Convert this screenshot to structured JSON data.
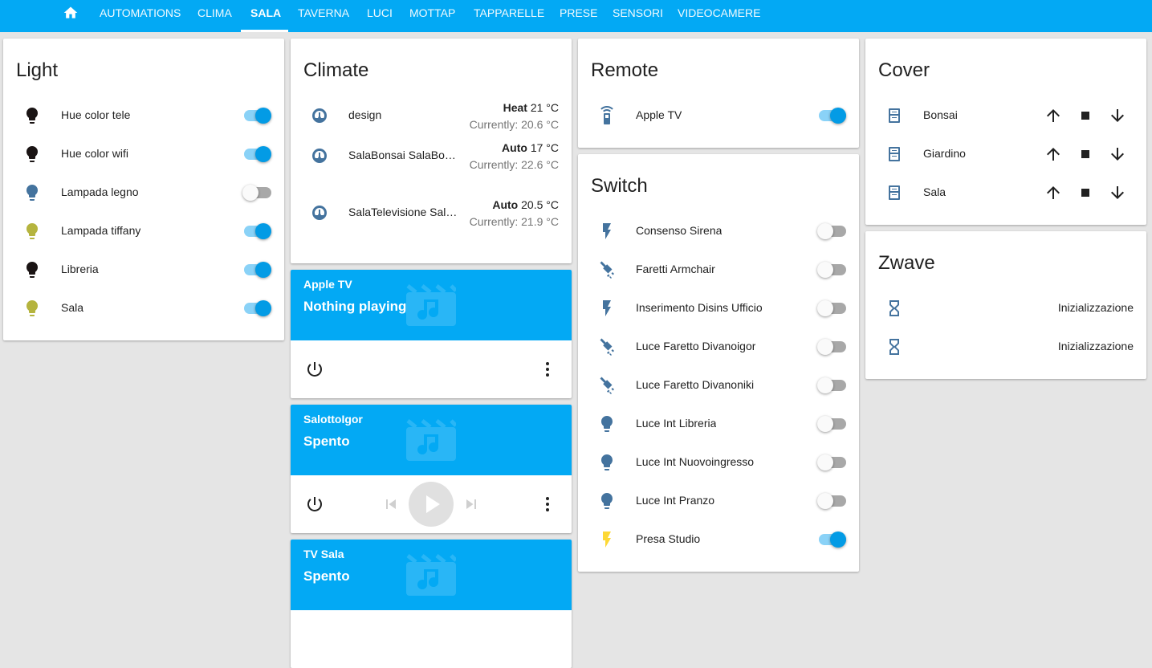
{
  "tabs": [
    "AUTOMATIONS",
    "CLIMA",
    "SALA",
    "TAVERNA",
    "LUCI",
    "MOTTAP",
    "TAPPARELLE",
    "PRESE",
    "SENSORI",
    "VIDEOCAMERE"
  ],
  "active_tab": "SALA",
  "colors": {
    "header": "#03a9f4",
    "toggle_on": "#039be5",
    "icon_blue": "#44739e",
    "bulb_dark": "#1a1414",
    "bulb_yellow": "#b5b43e",
    "bolt_yellow": "#fdd835"
  },
  "light": {
    "title": "Light",
    "items": [
      {
        "name": "Hue color tele",
        "on": true,
        "icon": "lightbulb-icon",
        "color": "#1a1414"
      },
      {
        "name": "Hue color wifi",
        "on": true,
        "icon": "lightbulb-icon",
        "color": "#1a1414"
      },
      {
        "name": "Lampada legno",
        "on": false,
        "icon": "lightbulb-icon",
        "color": "#44739e"
      },
      {
        "name": "Lampada tiffany",
        "on": true,
        "icon": "lightbulb-icon",
        "color": "#b5b43e"
      },
      {
        "name": "Libreria",
        "on": true,
        "icon": "lightbulb-icon",
        "color": "#1a1414"
      },
      {
        "name": "Sala",
        "on": true,
        "icon": "lightbulb-icon",
        "color": "#b5b43e"
      }
    ]
  },
  "climate": {
    "title": "Climate",
    "items": [
      {
        "name": "design",
        "mode": "Heat",
        "target": "21 °C",
        "current_label": "Currently: 20.6 °C"
      },
      {
        "name": "SalaBonsai SalaBon…",
        "mode": "Auto",
        "target": "17 °C",
        "current_label": "Currently: 22.6 °C"
      },
      {
        "name": "SalaTelevisione SalaTel…",
        "mode": "Auto",
        "target": "20.5 °C",
        "current_label": "Currently: 21.9 °C"
      }
    ]
  },
  "media": [
    {
      "name": "Apple TV",
      "state": "Nothing playing",
      "show_transport": false
    },
    {
      "name": "SalottoIgor",
      "state": "Spento",
      "show_transport": true
    },
    {
      "name": "TV Sala",
      "state": "Spento",
      "show_transport": false
    }
  ],
  "remote": {
    "title": "Remote",
    "items": [
      {
        "name": "Apple TV",
        "on": true
      }
    ]
  },
  "switch": {
    "title": "Switch",
    "items": [
      {
        "name": "Consenso Sirena",
        "on": false,
        "icon": "flash-icon"
      },
      {
        "name": "Faretti Armchair",
        "on": false,
        "icon": "spotlight-icon"
      },
      {
        "name": "Inserimento Disins Ufficio",
        "on": false,
        "icon": "flash-icon"
      },
      {
        "name": "Luce Faretto Divanoigor",
        "on": false,
        "icon": "spotlight-icon"
      },
      {
        "name": "Luce Faretto Divanoniki",
        "on": false,
        "icon": "spotlight-icon"
      },
      {
        "name": "Luce Int Libreria",
        "on": false,
        "icon": "lightbulb-icon"
      },
      {
        "name": "Luce Int Nuovoingresso",
        "on": false,
        "icon": "lightbulb-icon"
      },
      {
        "name": "Luce Int Pranzo",
        "on": false,
        "icon": "lightbulb-icon"
      },
      {
        "name": "Presa Studio",
        "on": true,
        "icon": "flash-icon"
      }
    ]
  },
  "cover": {
    "title": "Cover",
    "items": [
      {
        "name": "Bonsai"
      },
      {
        "name": "Giardino"
      },
      {
        "name": "Sala"
      }
    ]
  },
  "zwave": {
    "title": "Zwave",
    "items": [
      {
        "state": "Inizializzazione"
      },
      {
        "state": "Inizializzazione"
      }
    ]
  }
}
